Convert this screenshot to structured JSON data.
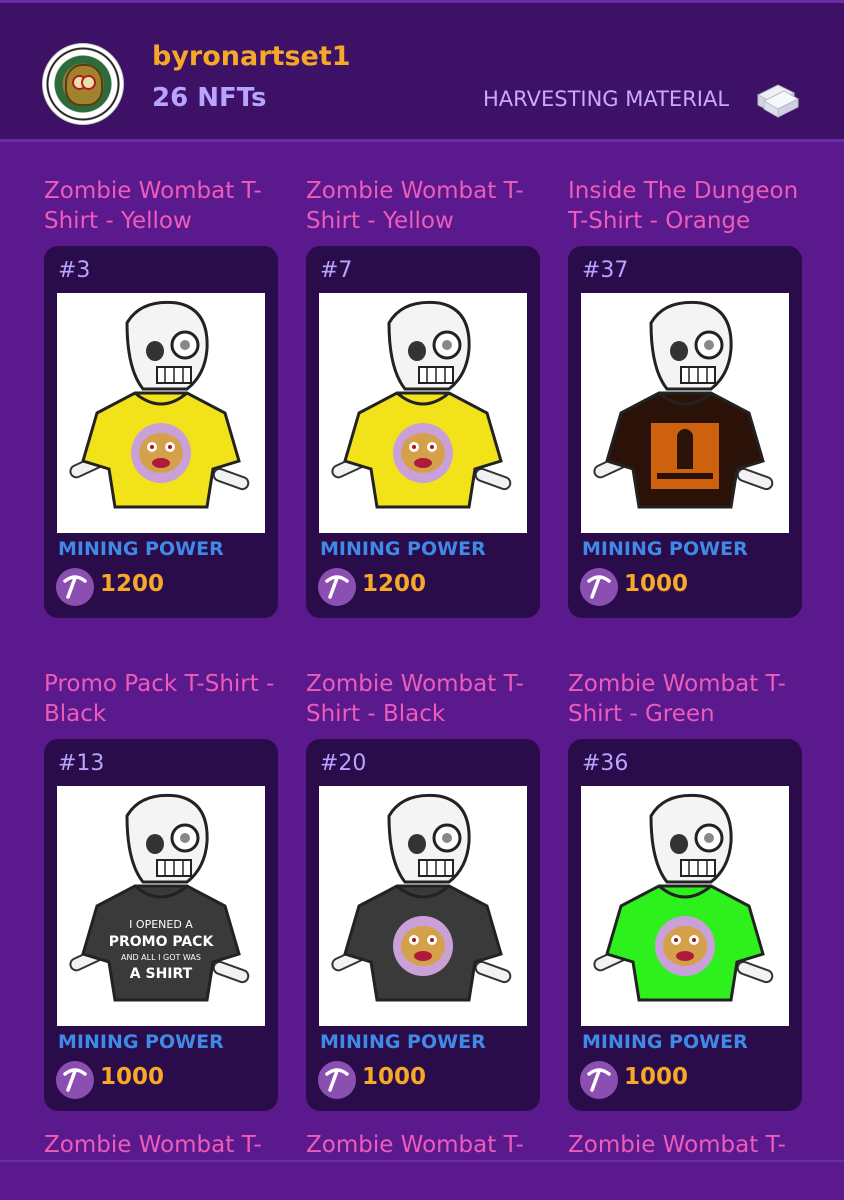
{
  "profile": {
    "username": "byronartset1",
    "nft_count": "26 NFTs",
    "harvest_label": "HARVESTING MATERIAL"
  },
  "cards": [
    {
      "title": "Zombie Wombat T-Shirt - Yellow",
      "number": "#3",
      "mp_label": "MINING POWER",
      "mp_value": "1200",
      "shirt_color": "#f2e21a",
      "print": "wombat"
    },
    {
      "title": "Zombie Wombat T-Shirt - Yellow",
      "number": "#7",
      "mp_label": "MINING POWER",
      "mp_value": "1200",
      "shirt_color": "#f2e21a",
      "print": "wombat"
    },
    {
      "title": "Inside The Dungeon T-Shirt - Orange",
      "number": "#37",
      "mp_label": "MINING POWER",
      "mp_value": "1000",
      "shirt_color": "#2a1208",
      "print": "dungeon"
    },
    {
      "title": "Promo Pack T-Shirt - Black",
      "number": "#13",
      "mp_label": "MINING POWER",
      "mp_value": "1000",
      "shirt_color": "#3a3a3a",
      "print": "promo",
      "print_text": [
        "I OPENED A",
        "PROMO PACK",
        "AND ALL I GOT WAS",
        "A SHIRT"
      ]
    },
    {
      "title": "Zombie Wombat T-Shirt - Black",
      "number": "#20",
      "mp_label": "MINING POWER",
      "mp_value": "1000",
      "shirt_color": "#3a3a3a",
      "print": "wombat"
    },
    {
      "title": "Zombie Wombat T-Shirt - Green",
      "number": "#36",
      "mp_label": "MINING POWER",
      "mp_value": "1000",
      "shirt_color": "#2ef01c",
      "print": "wombat"
    }
  ],
  "next_row_titles": [
    "Zombie Wombat T-",
    "Zombie Wombat T-",
    "Zombie Wombat T-"
  ],
  "colors": {
    "background": "#5a1a8e",
    "header": "#3d1166",
    "card": "#2b0c4b",
    "title_pink": "#ef5bb8",
    "username_orange": "#f7a826",
    "mining_blue": "#3f8ae6"
  },
  "icons": {
    "harvest": "silver-bars-icon",
    "mining": "pickaxe-icon"
  }
}
